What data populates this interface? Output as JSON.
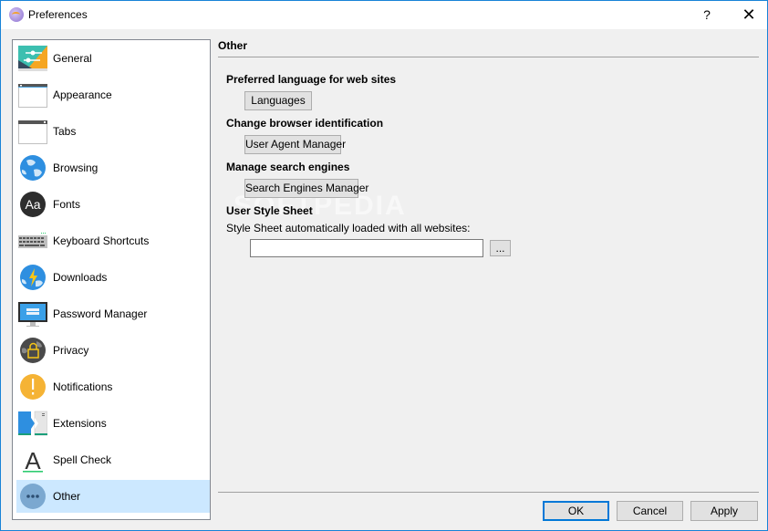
{
  "window": {
    "title": "Preferences",
    "help_label": "?",
    "close_label": "✕"
  },
  "sidebar": {
    "selected": "Other",
    "items": [
      {
        "label": "General",
        "icon": "general-icon"
      },
      {
        "label": "Appearance",
        "icon": "appearance-icon"
      },
      {
        "label": "Tabs",
        "icon": "tabs-icon"
      },
      {
        "label": "Browsing",
        "icon": "globe-icon"
      },
      {
        "label": "Fonts",
        "icon": "fonts-icon"
      },
      {
        "label": "Keyboard Shortcuts",
        "icon": "keyboard-icon"
      },
      {
        "label": "Downloads",
        "icon": "downloads-icon"
      },
      {
        "label": "Password Manager",
        "icon": "password-manager-icon"
      },
      {
        "label": "Privacy",
        "icon": "privacy-lock-icon"
      },
      {
        "label": "Notifications",
        "icon": "notification-icon"
      },
      {
        "label": "Extensions",
        "icon": "extensions-icon"
      },
      {
        "label": "Spell Check",
        "icon": "spell-check-icon"
      },
      {
        "label": "Other",
        "icon": "more-dots-icon"
      }
    ]
  },
  "main": {
    "section_title": "Other",
    "groups": {
      "language": {
        "heading": "Preferred language for web sites",
        "button": "Languages"
      },
      "identification": {
        "heading": "Change browser identification",
        "button": "User Agent Manager"
      },
      "search": {
        "heading": "Manage search engines",
        "button": "Search Engines Manager"
      },
      "stylesheet": {
        "heading": "User Style Sheet",
        "label": "Style Sheet automatically loaded with all websites:",
        "value": "",
        "browse_button": "..."
      }
    }
  },
  "footer": {
    "ok": "OK",
    "cancel": "Cancel",
    "apply": "Apply"
  },
  "watermark": "SOFTPEDIA"
}
